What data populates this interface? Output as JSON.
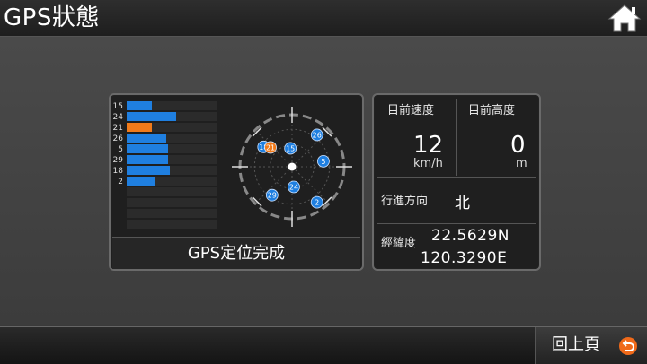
{
  "header": {
    "title": "GPS狀態"
  },
  "icons": {
    "home": "home-icon",
    "back": "back-arrow-icon"
  },
  "colors": {
    "bar_normal": "#1f7fe0",
    "bar_highlight": "#f07a1a",
    "sat_blue": "#1f7fe0",
    "sat_orange": "#f07a1a"
  },
  "satellites": {
    "bars": [
      {
        "id": "15",
        "strength": 0.28
      },
      {
        "id": "24",
        "strength": 0.55
      },
      {
        "id": "21",
        "strength": 0.28,
        "highlight": true
      },
      {
        "id": "26",
        "strength": 0.44
      },
      {
        "id": "5",
        "strength": 0.46
      },
      {
        "id": "29",
        "strength": 0.46
      },
      {
        "id": "18",
        "strength": 0.48
      },
      {
        "id": "2",
        "strength": 0.32
      }
    ],
    "sky": [
      {
        "id": "18",
        "az": 305,
        "el": 30,
        "color": "blue"
      },
      {
        "id": "21",
        "az": 312,
        "el": 40,
        "color": "orange"
      },
      {
        "id": "15",
        "az": 355,
        "el": 58,
        "color": "blue"
      },
      {
        "id": "26",
        "az": 38,
        "el": 20,
        "color": "blue"
      },
      {
        "id": "5",
        "az": 80,
        "el": 35,
        "color": "blue"
      },
      {
        "id": "29",
        "az": 215,
        "el": 30,
        "color": "blue"
      },
      {
        "id": "24",
        "az": 175,
        "el": 55,
        "color": "blue"
      },
      {
        "id": "2",
        "az": 145,
        "el": 15,
        "color": "blue"
      }
    ],
    "status": "GPS定位完成"
  },
  "info": {
    "speed_label": "目前速度",
    "speed_value": "12",
    "speed_unit": "km/h",
    "altitude_label": "目前高度",
    "altitude_value": "0",
    "altitude_unit": "m",
    "direction_label": "行進方向",
    "direction_value": "北",
    "coord_label": "經緯度",
    "latitude": "22.5629N",
    "longitude": "120.3290E"
  },
  "footer": {
    "back_label": "回上頁"
  }
}
